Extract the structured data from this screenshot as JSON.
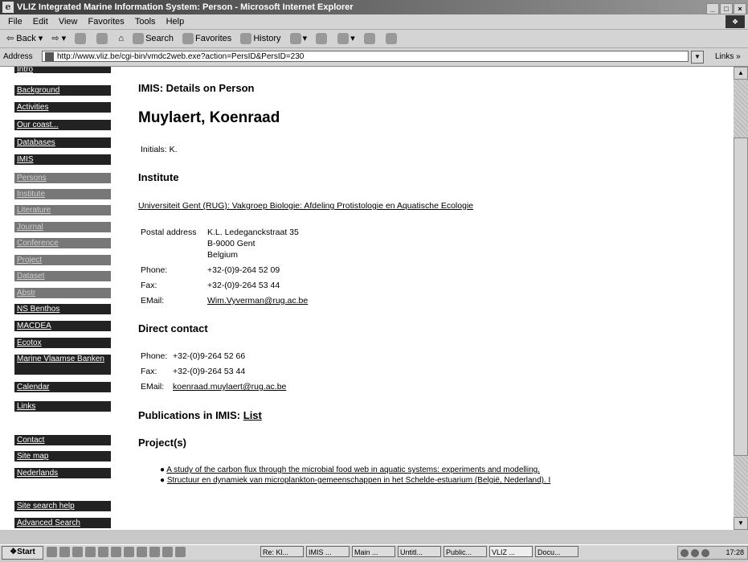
{
  "window": {
    "title": "VLIZ Integrated Marine Information System: Person - Microsoft Internet Explorer",
    "controls": [
      "_",
      "□",
      "×"
    ]
  },
  "menu": [
    "File",
    "Edit",
    "View",
    "Favorites",
    "Tools",
    "Help"
  ],
  "toolbar": {
    "back": "Back",
    "search": "Search",
    "favorites": "Favorites",
    "history": "History"
  },
  "address": {
    "label": "Address",
    "url": "http://www.vliz.be/cgi-bin/vmdc2web.exe?action=PersID&PersID=230",
    "links": "Links"
  },
  "sidebar": [
    {
      "label": "Intro",
      "dim": false
    },
    {
      "label": "Background",
      "dim": false
    },
    {
      "label": "Activities",
      "dim": false
    },
    {
      "label": "Our coast...",
      "dim": false
    },
    {
      "label": "Databases",
      "dim": false
    },
    {
      "label": "IMIS",
      "dim": false
    },
    {
      "label": "Persons",
      "dim": true
    },
    {
      "label": "Institute",
      "dim": true
    },
    {
      "label": "Literature",
      "dim": true
    },
    {
      "label": "Journal",
      "dim": true
    },
    {
      "label": "Conference",
      "dim": true
    },
    {
      "label": "Project",
      "dim": true
    },
    {
      "label": "Dataset",
      "dim": true
    },
    {
      "label": "Abstr",
      "dim": true
    },
    {
      "label": "NS Benthos",
      "dim": false
    },
    {
      "label": "MACDEA",
      "dim": false
    },
    {
      "label": "Ecotox",
      "dim": false
    },
    {
      "label": "Marine Vlaamse Banken",
      "dim": false
    },
    {
      "label": "Calendar",
      "dim": false
    },
    {
      "label": "Links",
      "dim": false
    },
    {
      "label": "Contact",
      "dim": false
    },
    {
      "label": "Site map",
      "dim": false
    },
    {
      "label": "Nederlands",
      "dim": false
    },
    {
      "label": "Site search help",
      "dim": false
    },
    {
      "label": "Advanced Search",
      "dim": false
    }
  ],
  "page": {
    "heading": "IMIS: Details on Person",
    "person_name": "Muylaert, Koenraad",
    "initials_label": "Initials:",
    "initials": "K.",
    "institute_heading": "Institute",
    "institute_name": "Universiteit Gent (RUG): Vakgroep Biologie: Afdeling Protistologie en Aquatische Ecologie",
    "postal_label": "Postal address",
    "postal_lines": [
      "K.L. Ledeganckstraat 35",
      "B-9000 Gent",
      "Belgium"
    ],
    "inst_phone_label": "Phone:",
    "inst_phone": "+32-(0)9-264 52 09",
    "inst_fax_label": "Fax:",
    "inst_fax": "+32-(0)9-264 53 44",
    "inst_email_label": "EMail:",
    "inst_email": "Wim.Vyverman@rug.ac.be",
    "direct_heading": "Direct contact",
    "dc_phone_label": "Phone:",
    "dc_phone": "+32-(0)9-264 52 66",
    "dc_fax_label": "Fax:",
    "dc_fax": "+32-(0)9-264 53 44",
    "dc_email_label": "EMail:",
    "dc_email": "koenraad.muylaert@rug.ac.be",
    "publications_heading": "Publications in IMIS:",
    "publications_link": "List",
    "projects_heading": "Project(s)",
    "projects": [
      "A study of the carbon flux through the microbial food web in aquatic systems: experiments and modelling.",
      "Structuur en dynamiek van microplankton-gemeenschappen in het Schelde-estuarium (België, Nederland). I"
    ]
  },
  "taskbar": {
    "start": "Start",
    "tasks": [
      "Re: Kl...",
      "IMIS ...",
      "Main ...",
      "Untitl...",
      "Public...",
      "VLIZ ...",
      "Docu..."
    ],
    "clock": "17:28"
  }
}
